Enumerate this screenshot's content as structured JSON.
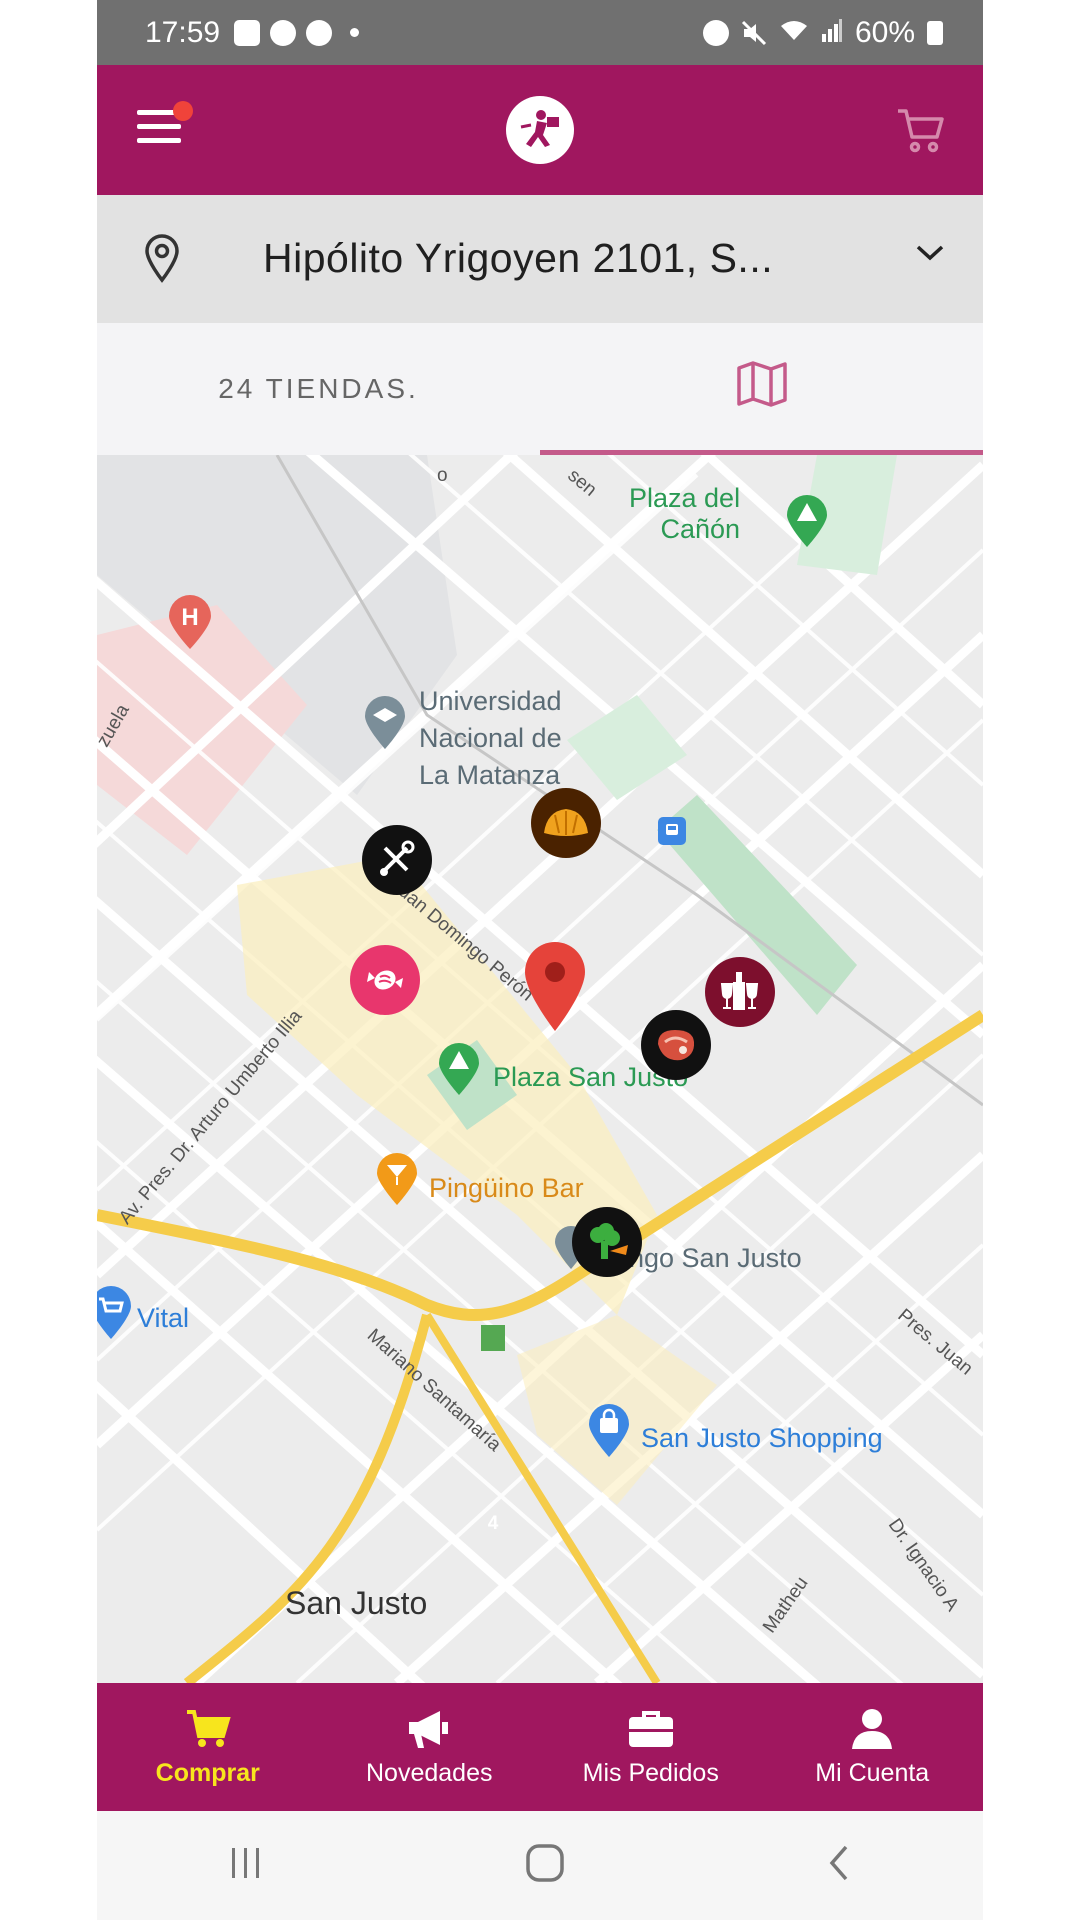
{
  "status_bar": {
    "time": "17:59",
    "battery": "60%"
  },
  "header": {
    "logo_icon": "runner-logo-icon",
    "cart_icon": "cart-icon",
    "accent": "#a0175f"
  },
  "address": {
    "text": "Hipólito Yrigoyen 2101, S..."
  },
  "tabs": {
    "list_label": "24 TIENDAS.",
    "map_icon": "map-icon"
  },
  "map": {
    "places": {
      "plaza_canon": "Plaza del\nCañón",
      "universidad": "Universidad\nNacional de\nLa Matanza",
      "plaza_sj": "Plaza San Justo",
      "pinguino": "Pingüino Bar",
      "domingo": "ingo San Justo",
      "vital": "Vital",
      "shopping": "San Justo Shopping",
      "san_justo": "San Justo",
      "route": "4"
    },
    "streets": {
      "zuela": "zuela",
      "juan_dom": "es. Juan Domingo Perón",
      "arturo": "Av. Pres. Dr. Arturo Umberto Illia",
      "mariano": "Mariano Santamaría",
      "pres_juan": "Pres. Juan",
      "matheu": "Matheu",
      "ignacio": "Dr. Ignacio A",
      "sen": "sen",
      "o": "o"
    }
  },
  "bottom_nav": [
    {
      "label": "Comprar",
      "icon": "cart-icon",
      "active": true
    },
    {
      "label": "Novedades",
      "icon": "megaphone-icon",
      "active": false
    },
    {
      "label": "Mis Pedidos",
      "icon": "briefcase-icon",
      "active": false
    },
    {
      "label": "Mi Cuenta",
      "icon": "user-icon",
      "active": false
    }
  ]
}
